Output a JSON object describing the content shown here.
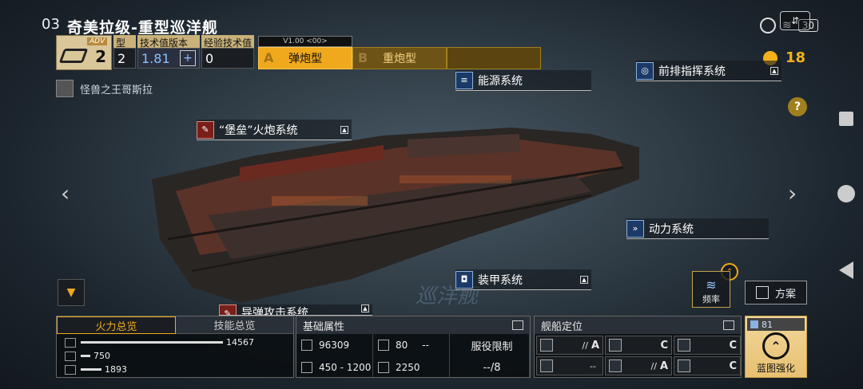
{
  "status_bar": {
    "time": "03",
    "battery": "30"
  },
  "ship": {
    "title": "奇美拉级-重型巡洋舰",
    "adv_tag": "ADV",
    "adv_value": "2",
    "model_label": "型号",
    "model_value": "2",
    "tech_label": "技术值版本",
    "tech_value": "1.81",
    "exp_label": "经验技术值",
    "exp_value": "0",
    "subtitle": "怪兽之王哥斯拉",
    "hull_watermark": "巡洋舰"
  },
  "variant": {
    "version": "V1.00 <00>",
    "tab_a_letter": "A",
    "tab_a_label": "弹炮型",
    "tab_b_letter": "B",
    "tab_b_label": "重炮型"
  },
  "credits": {
    "value": "18"
  },
  "modules": {
    "energy": "能源系统",
    "command": "前排指挥系统",
    "fort": "“堡垒”火炮系统",
    "power": "动力系统",
    "armor": "装甲系统",
    "missile": "导弹攻击系统"
  },
  "fire_panel": {
    "tab_active": "火力总览",
    "tab_other": "技能总览",
    "rows": [
      {
        "value": "14567",
        "fill": 0.74
      },
      {
        "value": "750",
        "fill": 0.05
      },
      {
        "value": "1893",
        "fill": 0.11
      }
    ]
  },
  "base_panel": {
    "title": "基础属性",
    "hp": "96309",
    "armor": "80",
    "dash": "--",
    "range": "450 - 1200",
    "speed": "2250",
    "service_label": "服役限制",
    "service_value": "--/8"
  },
  "role_panel": {
    "title": "舰船定位",
    "cells": [
      {
        "mark": "//",
        "grade": "A"
      },
      {
        "mark": "",
        "grade": "C"
      },
      {
        "mark": "",
        "grade": "C"
      },
      {
        "mark": "--",
        "grade": ""
      },
      {
        "mark": "//",
        "grade": "A"
      },
      {
        "mark": "",
        "grade": "C"
      }
    ]
  },
  "blueprint": {
    "count": "81",
    "label": "蓝图强化"
  },
  "freq_label": "频率",
  "plan_label": "方案",
  "colors": {
    "accent": "#f0a81c",
    "panel": "#1a1e22"
  }
}
